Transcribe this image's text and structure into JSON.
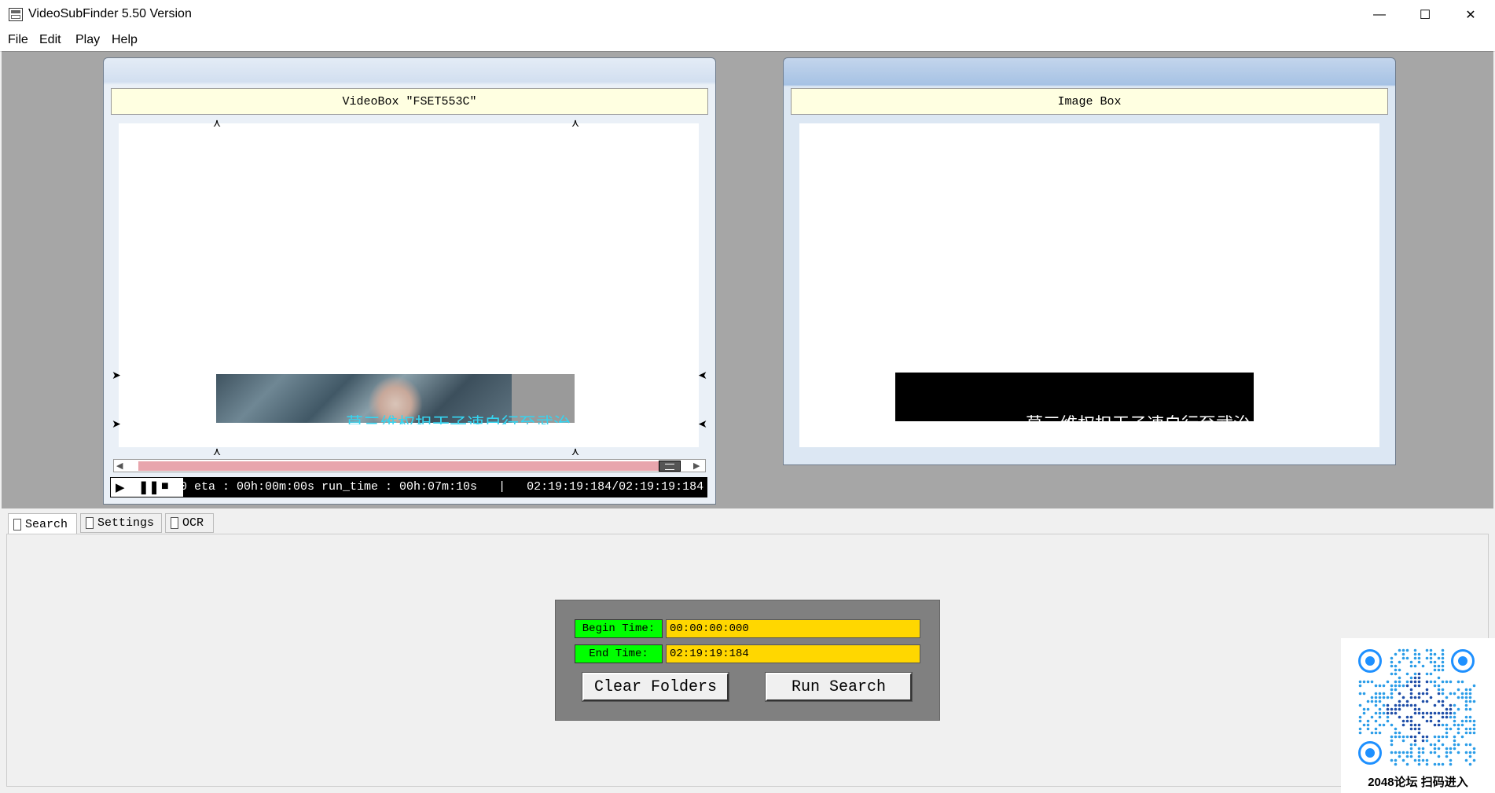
{
  "window": {
    "title": "VideoSubFinder 5.50 Version",
    "controls": {
      "minimize": "—",
      "maximize": "☐",
      "close": "✕"
    }
  },
  "menu": [
    "File",
    "Edit",
    "Play",
    "Help"
  ],
  "video_box": {
    "header": "VideoBox \"FSET553C\"",
    "subtitle_text": "莫三维权担干子速自行至武治"
  },
  "image_box": {
    "header": "Image Box",
    "subtitle_text": "莫三维权担干子速自行至武治"
  },
  "player": {
    "status": "0 eta : 00h:00m:00s run_time : 00h:07m:10s   |   02:19:19:184/02:19:19:184",
    "icons": [
      "play-icon",
      "pause-icon",
      "stop-icon"
    ]
  },
  "tabs": [
    {
      "label": "Search",
      "active": true
    },
    {
      "label": "Settings",
      "active": false
    },
    {
      "label": "OCR",
      "active": false
    }
  ],
  "search": {
    "begin_label": "Begin Time:",
    "begin_value": "00:00:00:000",
    "end_label": "End Time:",
    "end_value": "02:19:19:184",
    "clear_button": "Clear Folders",
    "run_button": "Run Search"
  },
  "qr": {
    "label": "2048论坛 扫码进入"
  },
  "colors": {
    "workspace": "#a6a6a6",
    "label_green": "#00ff00",
    "value_yellow": "#ffd700",
    "scroll_track": "#e8a5ad",
    "subtitle_cyan": "#35d4f0"
  }
}
